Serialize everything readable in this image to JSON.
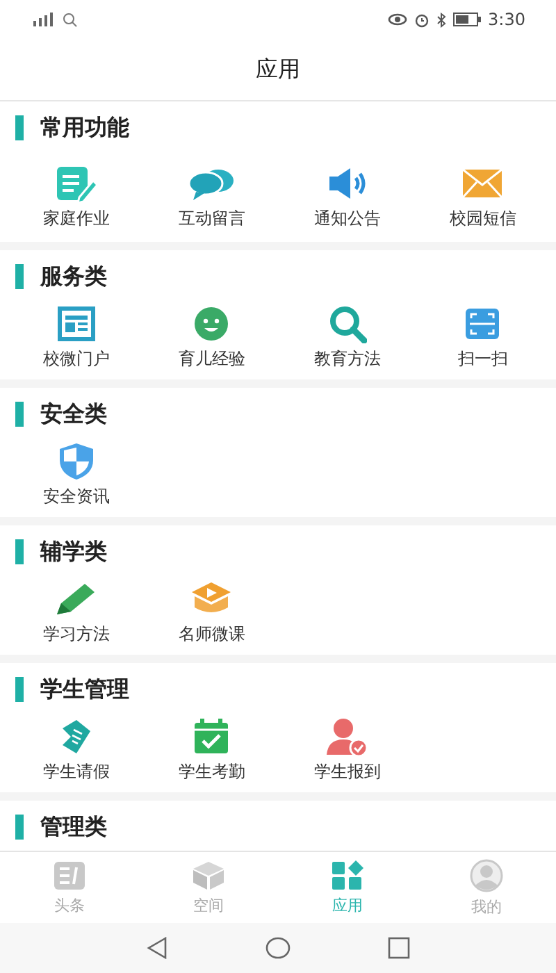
{
  "status_bar": {
    "time": "3:30"
  },
  "header": {
    "title": "应用"
  },
  "sections": [
    {
      "title": "常用功能",
      "items": [
        {
          "label": "家庭作业"
        },
        {
          "label": "互动留言"
        },
        {
          "label": "通知公告"
        },
        {
          "label": "校园短信"
        }
      ]
    },
    {
      "title": "服务类",
      "items": [
        {
          "label": "校微门户"
        },
        {
          "label": "育儿经验"
        },
        {
          "label": "教育方法"
        },
        {
          "label": "扫一扫"
        }
      ]
    },
    {
      "title": "安全类",
      "items": [
        {
          "label": "安全资讯"
        }
      ]
    },
    {
      "title": "辅学类",
      "items": [
        {
          "label": "学习方法"
        },
        {
          "label": "名师微课"
        }
      ]
    },
    {
      "title": "学生管理",
      "items": [
        {
          "label": "学生请假"
        },
        {
          "label": "学生考勤"
        },
        {
          "label": "学生报到"
        }
      ]
    },
    {
      "title": "管理类"
    }
  ],
  "tabs": [
    {
      "label": "头条",
      "selected": false
    },
    {
      "label": "空间",
      "selected": false
    },
    {
      "label": "应用",
      "selected": true
    },
    {
      "label": "我的",
      "selected": false
    }
  ]
}
